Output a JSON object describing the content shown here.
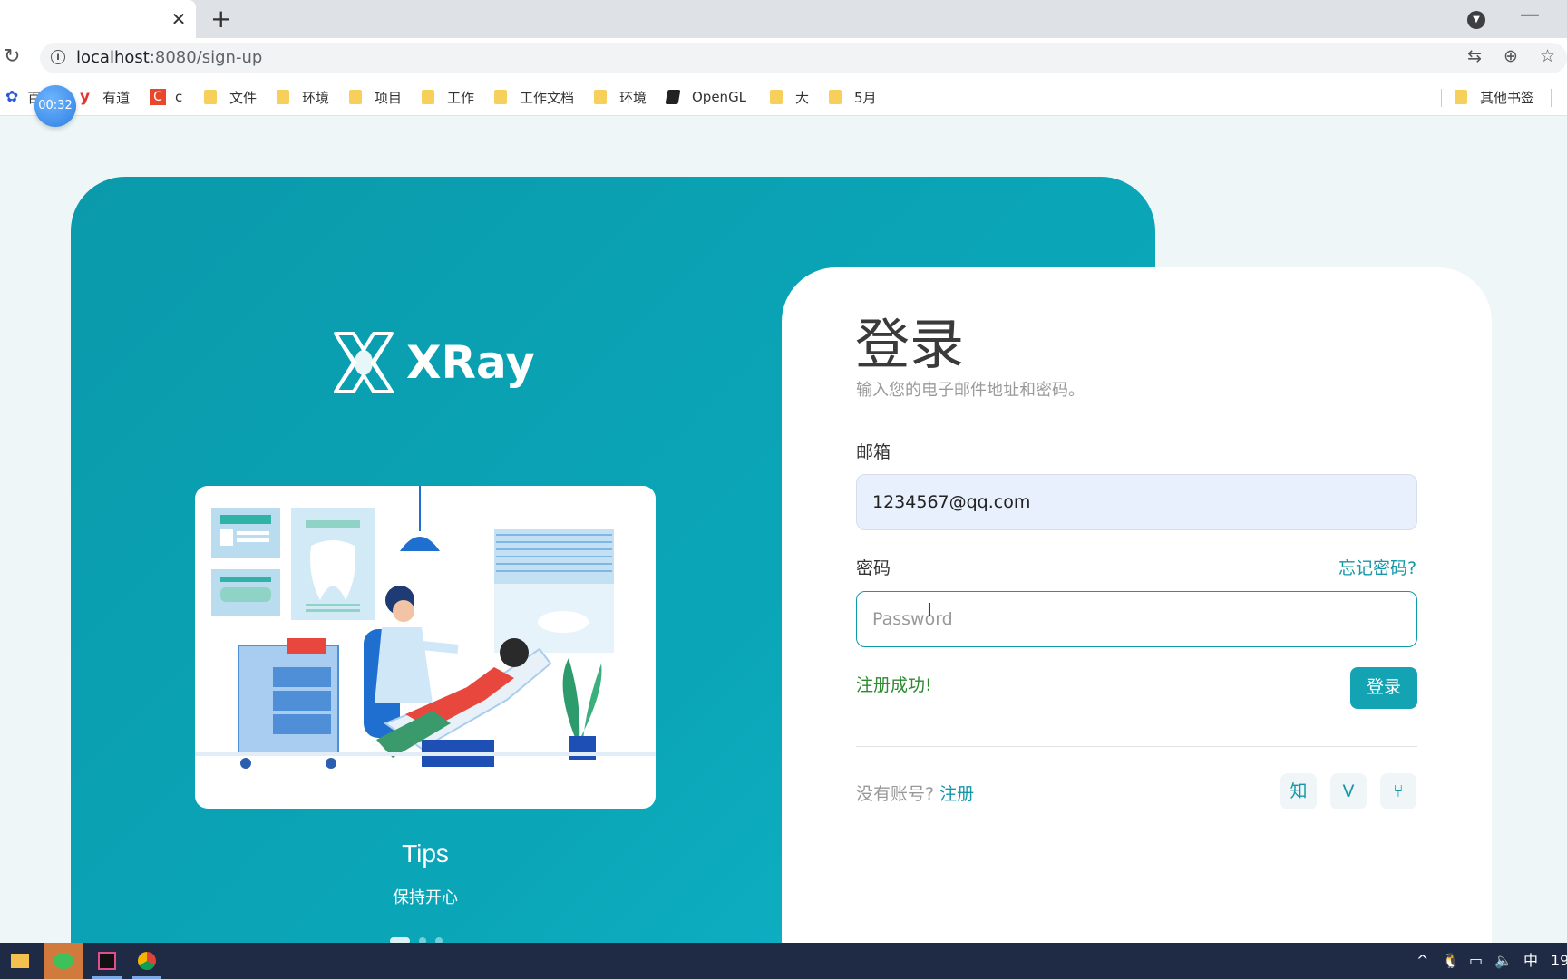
{
  "browser": {
    "tab_close_glyph": "✕",
    "new_tab_glyph": "+",
    "tab_menu_glyph": "▼",
    "minimize_glyph": "—",
    "reload_glyph": "↻",
    "info_glyph": "i",
    "url_host": "localhost",
    "url_path": ":8080/sign-up",
    "translate_glyph": "⇆",
    "zoom_glyph": "⊕",
    "star_glyph": "☆"
  },
  "bookmarks": {
    "timer": "00:32",
    "items": [
      {
        "label": "百",
        "icon": "paw-icon"
      },
      {
        "label": "有道",
        "icon": "youdao-icon"
      },
      {
        "label": "c",
        "icon": "c-logo-icon"
      },
      {
        "label": "文件",
        "icon": "folder-icon"
      },
      {
        "label": "环境",
        "icon": "folder-icon"
      },
      {
        "label": "项目",
        "icon": "folder-icon"
      },
      {
        "label": "工作",
        "icon": "folder-icon"
      },
      {
        "label": "工作文档",
        "icon": "folder-icon"
      },
      {
        "label": "环境",
        "icon": "folder-icon"
      },
      {
        "label": "OpenGL",
        "icon": "book-icon"
      },
      {
        "label": "大",
        "icon": "folder-icon"
      },
      {
        "label": "5月",
        "icon": "folder-icon"
      }
    ],
    "other": "其他书签"
  },
  "brand": {
    "name": "XRay",
    "tips_title": "Tips",
    "tips_subtitle": "保持开心"
  },
  "login": {
    "title": "登录",
    "subtitle": "输入您的电子邮件地址和密码。",
    "email_label": "邮箱",
    "email_value": "1234567@qq.com",
    "password_label": "密码",
    "forgot": "忘记密码?",
    "password_placeholder": "Password",
    "success_message": "注册成功!",
    "submit": "登录",
    "no_account": "没有账号?",
    "register": "注册",
    "social": [
      {
        "name": "zhihu",
        "glyph": "知"
      },
      {
        "name": "vue",
        "glyph": "V"
      },
      {
        "name": "git",
        "glyph": "⑂"
      }
    ]
  },
  "taskbar": {
    "tray_ime": "中",
    "tray_time": "19"
  },
  "colors": {
    "brand_teal": "#0aa6b8",
    "success_green": "#2c8a2f"
  }
}
